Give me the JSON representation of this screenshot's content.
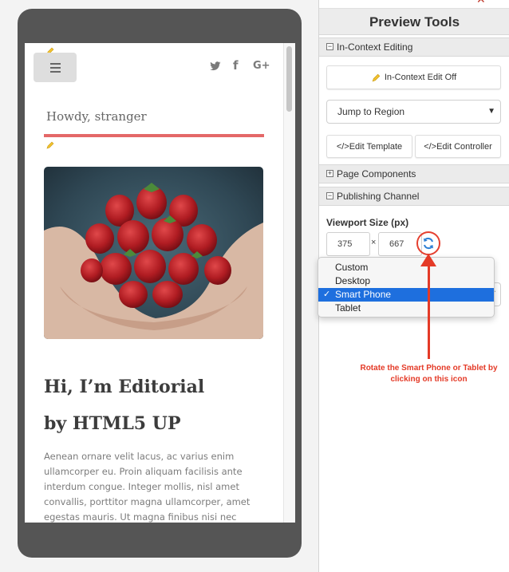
{
  "preview": {
    "greeting": "Howdy, stranger",
    "heading_line1": "Hi, I’m Editorial",
    "heading_line2": "by HTML5 UP",
    "paragraph": "Aenean ornare velit lacus, ac varius enim ullamcorper eu. Proin aliquam facilisis ante interdum congue. Integer mollis, nisl amet convallis, porttitor magna ullamcorper, amet egestas mauris. Ut magna finibus nisi nec lacinia.",
    "social": {
      "twitter": "twitter-icon",
      "facebook": "f",
      "google": "G+"
    }
  },
  "panel": {
    "title": "Preview Tools",
    "close_glyph": "✕",
    "sections": {
      "in_context_editing": "In-Context Editing",
      "page_components": "Page Components",
      "publishing_channel": "Publishing Channel"
    },
    "in_context_edit_button": "In-Context Edit Off",
    "jump_select": "Jump to Region",
    "edit_template_button": "</>Edit Template",
    "edit_controller_button": "</>Edit Controller",
    "viewport_label": "Viewport Size (px)",
    "viewport_width": "375",
    "viewport_height": "667",
    "viewport_sep": "×"
  },
  "device_dropdown": {
    "options": [
      "Custom",
      "Desktop",
      "Smart Phone",
      "Tablet"
    ],
    "selected": "Smart Phone",
    "check_glyph": "✓"
  },
  "annotation": {
    "text": "Rotate the Smart Phone or Tablet by clicking on this icon",
    "color": "#e43a27"
  },
  "colors": {
    "accent_red_line": "#e46868",
    "selection_blue": "#1e6fde",
    "pencil": "#f2c230",
    "refresh_icon": "#2d7fd4"
  }
}
